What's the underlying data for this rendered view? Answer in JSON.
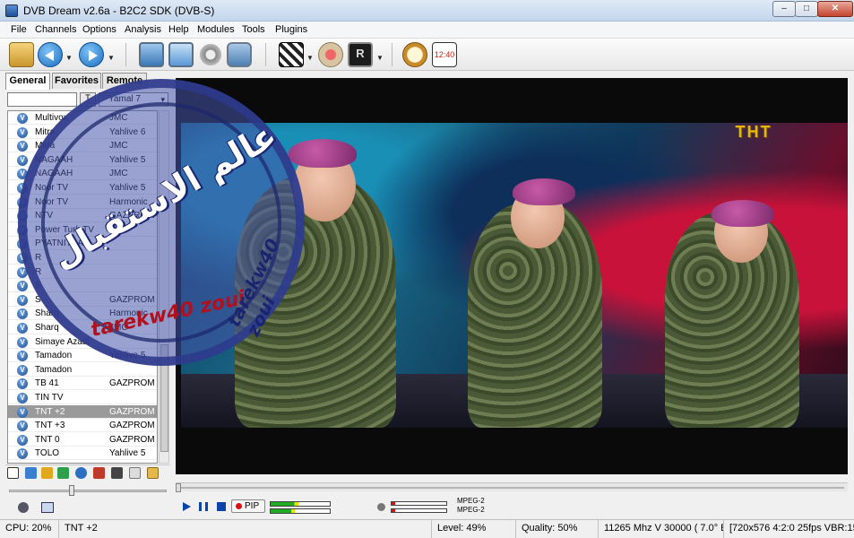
{
  "window": {
    "title": "DVB Dream v2.6a - B2C2 SDK (DVB-S)",
    "minimize_label": "–",
    "maximize_label": "□",
    "close_label": "✕"
  },
  "menu": [
    "File",
    "Channels",
    "Options",
    "Analysis",
    "Help",
    "Modules",
    "Tools",
    "Plugins"
  ],
  "toolbar": {
    "record_label": "R",
    "timer_label": "12:40",
    "icons": [
      "open-folder-icon",
      "back-icon",
      "forward-icon",
      "monitor-icon",
      "monitor-settings-icon",
      "gear-icon",
      "screen-icon",
      "clapperboard-icon",
      "stop-record-icon",
      "record-icon",
      "clock-icon",
      "timer-icon"
    ]
  },
  "sidebar": {
    "tabs": [
      "General",
      "Favorites",
      "Remote"
    ],
    "filter_button": "T",
    "satellite": "Yamal 7",
    "channels": [
      {
        "name": "Multivox",
        "provider": "JMC"
      },
      {
        "name": "Mitra",
        "provider": "Yahlive 6"
      },
      {
        "name": "Mitra",
        "provider": "JMC"
      },
      {
        "name": "NAGAAH",
        "provider": "Yahlive 5"
      },
      {
        "name": "NAGAAH",
        "provider": "JMC"
      },
      {
        "name": "Noor TV",
        "provider": "Yahlive 5"
      },
      {
        "name": "Noor TV",
        "provider": "Harmonic"
      },
      {
        "name": "NTV",
        "provider": "GAZPROM"
      },
      {
        "name": "Power Turk TV",
        "provider": ""
      },
      {
        "name": "PYATNITSA",
        "provider": ""
      },
      {
        "name": "R",
        "provider": ""
      },
      {
        "name": "R",
        "provider": ""
      },
      {
        "name": "S",
        "provider": ""
      },
      {
        "name": "S",
        "provider": "GAZPROM"
      },
      {
        "name": "Sharq",
        "provider": "Harmonic"
      },
      {
        "name": "Sharq",
        "provider": "JMC"
      },
      {
        "name": "Simaye Azadi",
        "provider": ""
      },
      {
        "name": "Tamadon",
        "provider": "Yahlive 5"
      },
      {
        "name": "Tamadon",
        "provider": ""
      },
      {
        "name": "TB 41",
        "provider": "GAZPROM"
      },
      {
        "name": "TIN TV",
        "provider": ""
      },
      {
        "name": "TNT +2",
        "provider": "GAZPROM",
        "selected": true
      },
      {
        "name": "TNT +3",
        "provider": "GAZPROM"
      },
      {
        "name": "TNT 0",
        "provider": "GAZPROM"
      },
      {
        "name": "TOLO",
        "provider": "Yahlive 5"
      }
    ],
    "channel_icon_letter": "V"
  },
  "video": {
    "channel_logo": "THT"
  },
  "player": {
    "pip_label": "PIP",
    "codec_video": "MPEG-2",
    "codec_audio": "MPEG-2",
    "left_level": 0.4,
    "right_level": 0.35
  },
  "status": {
    "cpu": "CPU: 20%",
    "channel": "TNT +2",
    "level": "Level: 49%",
    "quality": "Quality: 50%",
    "tuning": "11265 Mhz  V  30000  ( 7.0° E)",
    "stream": "[720x576 4:2:0 25fps  VBR:15"
  },
  "watermark": {
    "arabic": "عالم الاستقبال",
    "author": "tarekw40 zoui",
    "author_vertical": "tarekw40 zoui"
  }
}
